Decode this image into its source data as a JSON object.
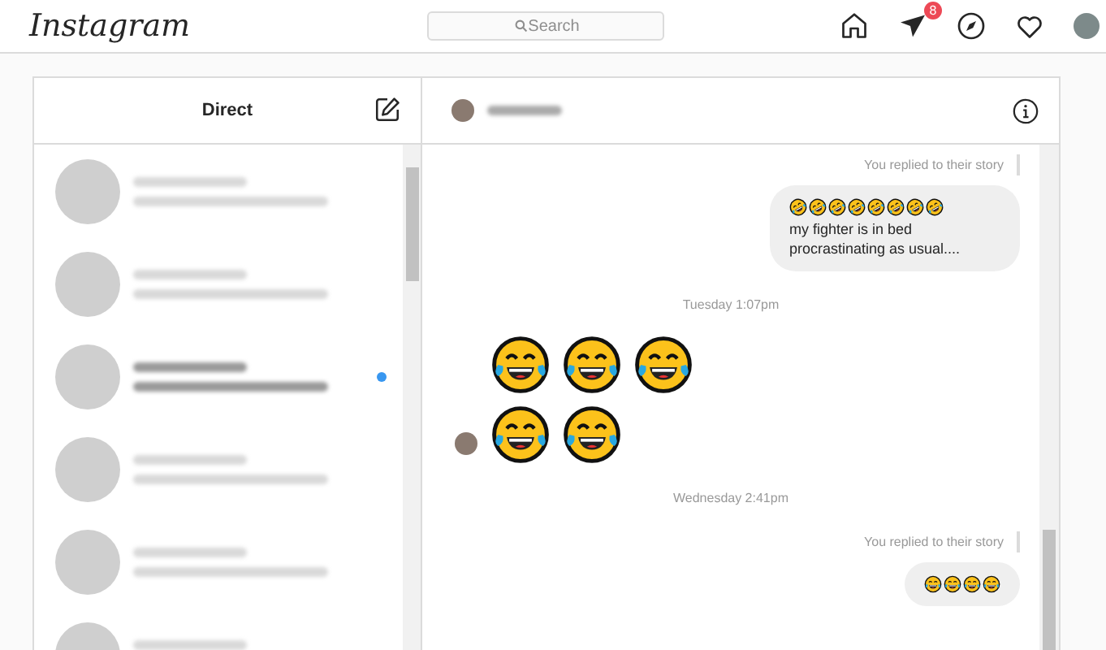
{
  "top_bar": {
    "logo": "Instagram",
    "search": {
      "placeholder": "Search"
    },
    "direct_badge": "8"
  },
  "inbox": {
    "title": "Direct",
    "threads": [
      {
        "unread": false
      },
      {
        "unread": false
      },
      {
        "unread": true
      },
      {
        "unread": false
      },
      {
        "unread": false
      },
      {
        "unread": false
      }
    ]
  },
  "chat": {
    "messages": [
      {
        "kind": "story_note",
        "text": "You replied to their story"
      },
      {
        "kind": "bubble",
        "emojis": [
          {
            "kind": "rofl"
          },
          {
            "kind": "rofl"
          },
          {
            "kind": "rofl"
          },
          {
            "kind": "rofl"
          },
          {
            "kind": "rofl"
          },
          {
            "kind": "rofl"
          },
          {
            "kind": "rofl"
          },
          {
            "kind": "rofl"
          }
        ],
        "text": "my fighter is in bed procrastinating as usual...."
      },
      {
        "kind": "time",
        "text": "Tuesday 1:07pm"
      },
      {
        "kind": "jumbo",
        "emojis": [
          {
            "kind": "joy"
          },
          {
            "kind": "joy"
          },
          {
            "kind": "joy"
          },
          {
            "kind": "joy"
          },
          {
            "kind": "joy"
          }
        ]
      },
      {
        "kind": "time",
        "text": "Wednesday 2:41pm"
      },
      {
        "kind": "story_note",
        "text": "You replied to their story"
      },
      {
        "kind": "bubble",
        "emojis": [
          {
            "kind": "joy"
          },
          {
            "kind": "joy"
          },
          {
            "kind": "joy"
          },
          {
            "kind": "joy"
          }
        ]
      }
    ]
  }
}
